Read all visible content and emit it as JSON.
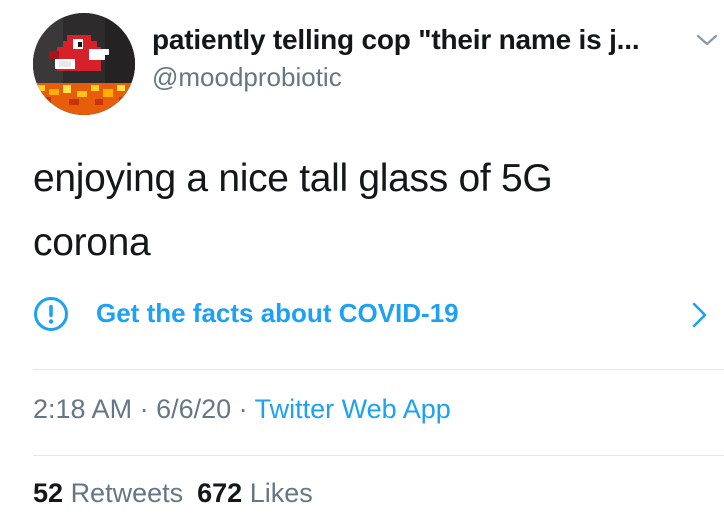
{
  "author": {
    "display_name": "patiently telling cop \"their name is j...",
    "handle": "@moodprobiotic",
    "avatar_icon": "pixel-bird-avatar-icon"
  },
  "menu": {
    "icon": "chevron-down-icon"
  },
  "tweet": {
    "line1": "enjoying a nice tall glass of 5G",
    "line2": "corona"
  },
  "covid_banner": {
    "icon": "exclamation-circle-icon",
    "label": "Get the facts about COVID-19",
    "chevron_icon": "chevron-right-icon"
  },
  "meta": {
    "time": "2:18 AM",
    "separator1": " · ",
    "date": "6/6/20",
    "separator2": " · ",
    "source": "Twitter Web App"
  },
  "stats": {
    "retweets_count": "52",
    "retweets_label": "Retweets",
    "likes_count": "672",
    "likes_label": "Likes"
  },
  "colors": {
    "accent": "#1da1f2",
    "text": "#14171a",
    "secondary": "#657786",
    "divider": "#e1e8ed"
  }
}
